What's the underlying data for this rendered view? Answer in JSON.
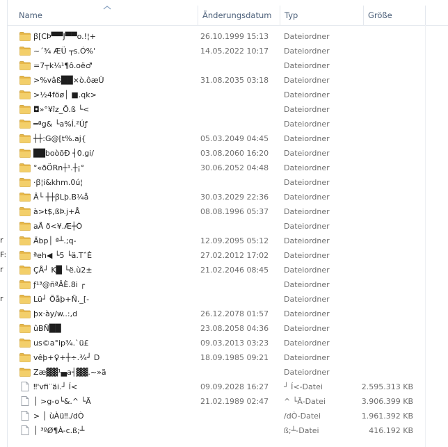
{
  "columns": {
    "name": "Name",
    "date": "Änderungsdatum",
    "type": "Typ",
    "size": "Größe"
  },
  "left_pane_fragments": [
    "r",
    "F:",
    "r",
    "r"
  ],
  "icons": {
    "folder": "folder-icon",
    "file": "file-icon",
    "sort": "sort-ascending-icon"
  },
  "colors": {
    "folder": "#e8b84a",
    "header_text": "#4c607a",
    "meta_text": "#6d6d6d"
  },
  "files": [
    {
      "kind": "folder",
      "name": "ꞵ[CÞ▀▀J▀▀o.!¦+",
      "date": "26.10.1999 15:13",
      "type": "Dateiordner",
      "size": ""
    },
    {
      "kind": "folder",
      "name": "~´¾   ÆÜ ┬s.Ó%'",
      "date": "14.05.2022 10:17",
      "type": "Dateiordner",
      "size": ""
    },
    {
      "kind": "folder",
      "name": "=7┬k¼¹¶ô.oë♂",
      "date": "",
      "type": "Dateiordner",
      "size": ""
    },
    {
      "kind": "folder",
      "name": ">%vâß██×ò.ôæÛ",
      "date": "31.08.2035 03:18",
      "type": "Dateiordner",
      "size": ""
    },
    {
      "kind": "folder",
      "name": ">½4föø│ ■.qk>",
      "date": "",
      "type": "Dateiordner",
      "size": ""
    },
    {
      "kind": "folder",
      "name": "◘»°¥îz_Õ.ß └<",
      "date": "",
      "type": "Dateiordner",
      "size": ""
    },
    {
      "kind": "folder",
      "name": "═ªg& └a%Í.²Úƒ",
      "date": "",
      "type": "Dateiordner",
      "size": ""
    },
    {
      "kind": "folder",
      "name": "┼┼:G@[t%.aj{",
      "date": "05.03.2049 04:45",
      "type": "Dateiordner",
      "size": ""
    },
    {
      "kind": "folder",
      "name": "██boòõÐ ┤0.gi/",
      "date": "03.08.2060 16:20",
      "type": "Dateiordner",
      "size": ""
    },
    {
      "kind": "folder",
      "name": "°«ðÖRn┼¹.┼¡°",
      "date": "30.06.2052 04:48",
      "type": "Dateiordner",
      "size": ""
    },
    {
      "kind": "folder",
      "name": "·ꞵ¦i&khm.0ú¦",
      "date": "",
      "type": "Dateiordner",
      "size": ""
    },
    {
      "kind": "folder",
      "name": "Â└ ┼┼ꞵLþ.B¼å",
      "date": "30.03.2029 22:36",
      "type": "Dateiordner",
      "size": ""
    },
    {
      "kind": "folder",
      "name": "à>t$,ßÞ.j+Å",
      "date": "08.08.1996 05:37",
      "type": "Dateiordner",
      "size": ""
    },
    {
      "kind": "folder",
      "name": "aÅ ð<¥.Æ┼Ò",
      "date": "",
      "type": "Dateiordner",
      "size": ""
    },
    {
      "kind": "folder",
      "name": "Äbp│ ª┴.;q-",
      "date": "12.09.2095 05:12",
      "type": "Dateiordner",
      "size": ""
    },
    {
      "kind": "folder",
      "name": "ªeh◀ └5 └ä.TˆÈ",
      "date": "27.02.2012 17:02",
      "type": "Dateiordner",
      "size": ""
    },
    {
      "kind": "folder",
      "name": "ÇÅ┘ K█ └ë.ù2±",
      "date": "21.02.2046 08:45",
      "type": "Dateiordner",
      "size": ""
    },
    {
      "kind": "folder",
      "name": "ƒ¹³@ñªÂÈ.8i ┌",
      "date": "",
      "type": "Dateiordner",
      "size": ""
    },
    {
      "kind": "folder",
      "name": "Lü┘ Õåþ+Ñ._[-",
      "date": "",
      "type": "Dateiordner",
      "size": ""
    },
    {
      "kind": "folder",
      "name": "þx·ày/w..:,d",
      "date": "26.12.2078 01:57",
      "type": "Dateiordner",
      "size": ""
    },
    {
      "kind": "folder",
      "name": "ûBÑ██",
      "date": "23.08.2058 04:36",
      "type": "Dateiordner",
      "size": ""
    },
    {
      "kind": "folder",
      "name": "us©a°ip¾.`ü£",
      "date": "09.03.2013 03:23",
      "type": "Dateiordner",
      "size": ""
    },
    {
      "kind": "folder",
      "name": "vêþ+♀+┼÷.¾┘ D",
      "date": "18.09.1985 09:21",
      "type": "Dateiordner",
      "size": ""
    },
    {
      "kind": "folder",
      "name": "Zæ▓▓¹▄a┤▓▓.~»ä",
      "date": "",
      "type": "Dateiordner",
      "size": ""
    },
    {
      "kind": "file",
      "name": "‼'vfi¨äi.┘ Í<",
      "date": "09.09.2028 16:27",
      "type": "┘ Í<-Datei",
      "size": "2.595.313 KB"
    },
    {
      "kind": "file",
      "name": "│ >g-o└&.^ └Ã",
      "date": "21.02.1989 02:47",
      "type": "^ └Ã-Datei",
      "size": "3.906.399 KB"
    },
    {
      "kind": "file",
      "name": ">   │ ùÀü‼./dÒ",
      "date": "",
      "type": "/dÒ-Datei",
      "size": "1.961.392 KB"
    },
    {
      "kind": "file",
      "name": "│ ³ºØ¶À-c.ß;┴",
      "date": "",
      "type": "ß;┴-Datei",
      "size": "416.192 KB"
    }
  ]
}
